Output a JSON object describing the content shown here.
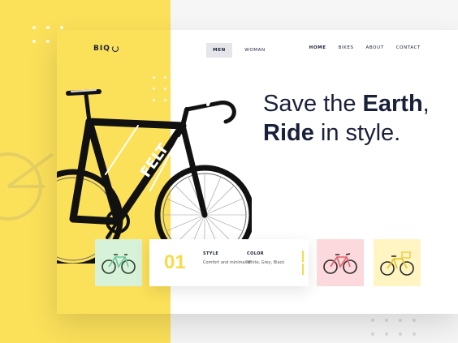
{
  "brand": {
    "logo": "BIQ"
  },
  "header": {
    "gender_tabs": [
      "MEN",
      "WOMAN"
    ],
    "nav": [
      "HOME",
      "BIKES",
      "ABOUT",
      "CONTACT"
    ],
    "active_nav": "HOME"
  },
  "hero": {
    "line1_regular": "Save the ",
    "line1_bold": "Earth",
    "line1_end": ",",
    "line2_bold": "Ride",
    "line2_regular": " in style."
  },
  "specs": {
    "number": "01",
    "style_label": "STYLE",
    "style_value": "Comfort and minimalist",
    "color_label": "COLOR",
    "color_value": "White, Grey, Black"
  },
  "colors": {
    "yellow": "#fbe05a",
    "navy": "#1a1f3a",
    "green_thumb": "#d7f2d8",
    "pink_thumb": "#fbd9dc",
    "cream_thumb": "#fff5c2"
  },
  "thumbnails": [
    "green-bike",
    "pink-bike",
    "yellow-bike"
  ]
}
